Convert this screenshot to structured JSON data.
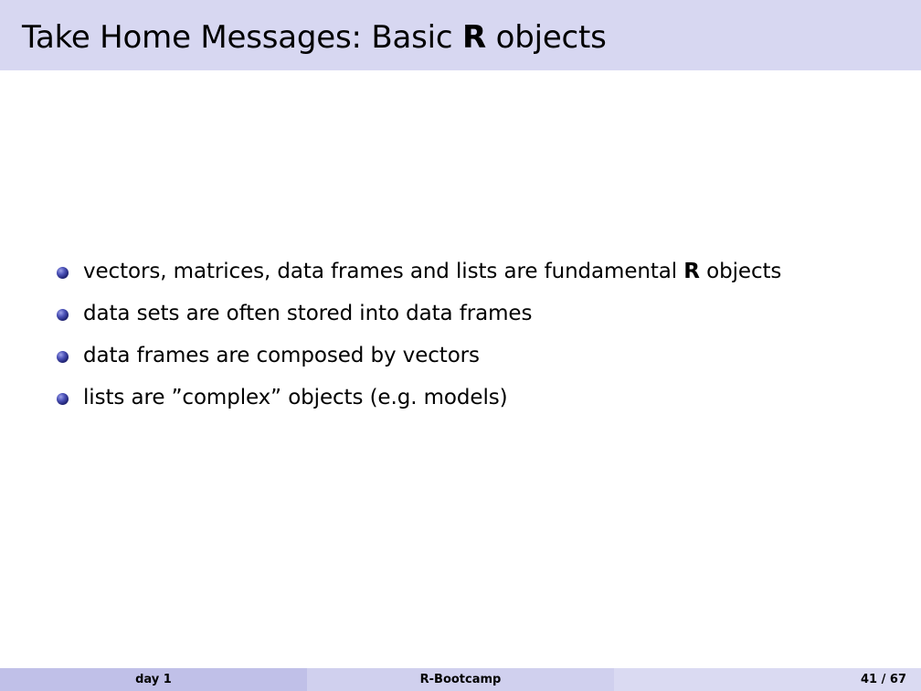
{
  "slide": {
    "title_prefix": "Take Home Messages: Basic ",
    "title_bold": "R",
    "title_suffix": " objects",
    "bullets": [
      {
        "before": "vectors, matrices, data frames and lists are fundamental ",
        "bold": "R",
        "after": " objects"
      },
      {
        "before": "data sets are often stored into data frames",
        "bold": "",
        "after": ""
      },
      {
        "before": "data frames are composed by vectors",
        "bold": "",
        "after": ""
      },
      {
        "before": "lists are ”complex” objects (e.g. models)",
        "bold": "",
        "after": ""
      }
    ]
  },
  "footer": {
    "left": "day 1",
    "center": "R-Bootcamp",
    "right": "41 / 67"
  },
  "colors": {
    "header_background": "#d7d7f1",
    "footer_left": "#c0c0e8",
    "footer_center": "#d0d0ee",
    "footer_right": "#dadaf2",
    "bullet_ball": "#2b2f8a"
  }
}
